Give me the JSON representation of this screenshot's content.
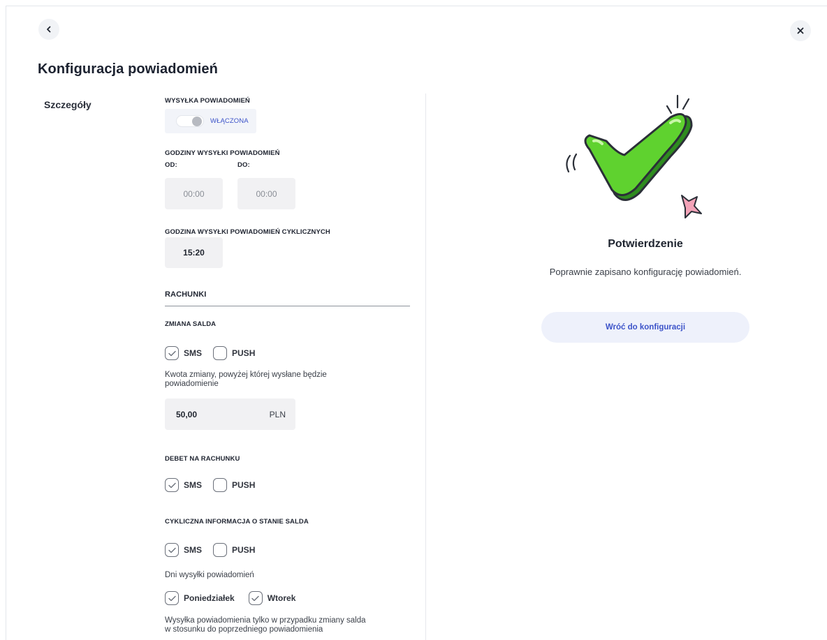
{
  "header": {
    "title": "Konfiguracja powiadomień"
  },
  "details": {
    "section_label": "Szczegóły",
    "sending": {
      "label": "WYSYŁKA POWIADOMIEŃ",
      "toggle_state": "WŁĄCZONA",
      "enabled": true
    },
    "hours": {
      "label": "GODZINY WYSYŁKI POWIADOMIEŃ",
      "from_label": "OD:",
      "to_label": "DO:",
      "from_value": "00:00",
      "to_value": "00:00"
    },
    "cyclic_hour": {
      "label": "GODZINA WYSYŁKI POWIADOMIEŃ CYKLICZNYCH",
      "value": "15:20"
    },
    "accounts": {
      "heading": "RACHUNKI",
      "balance_change": {
        "label": "ZMIANA SALDA",
        "sms_label": "SMS",
        "push_label": "PUSH",
        "amount_description": "Kwota zmiany, powyżej której wysłane będzie powiadomienie",
        "amount_value": "50,00",
        "currency": "PLN"
      },
      "overdraft": {
        "label": "DEBET NA RACHUNKU",
        "sms_label": "SMS",
        "push_label": "PUSH"
      },
      "cyclic_balance": {
        "label": "CYKLICZNA INFORMACJA O STANIE SALDA",
        "sms_label": "SMS",
        "push_label": "PUSH",
        "days_label": "Dni wysyłki powiadomień",
        "day1_label": "Poniedziałek",
        "day2_label": "Wtorek",
        "note": "Wysyłka powiadomienia tylko w przypadku zmiany salda w stosunku do poprzedniego powiadomienia"
      }
    }
  },
  "confirmation": {
    "title": "Potwierdzenie",
    "message": "Poprawnie zapisano konfigurację powiadomień.",
    "return_button": "Wróć do konfiguracji"
  },
  "colors": {
    "accent": "#3c53c9",
    "check_green": "#5fd22f",
    "field_bg": "#f1f1f3"
  }
}
